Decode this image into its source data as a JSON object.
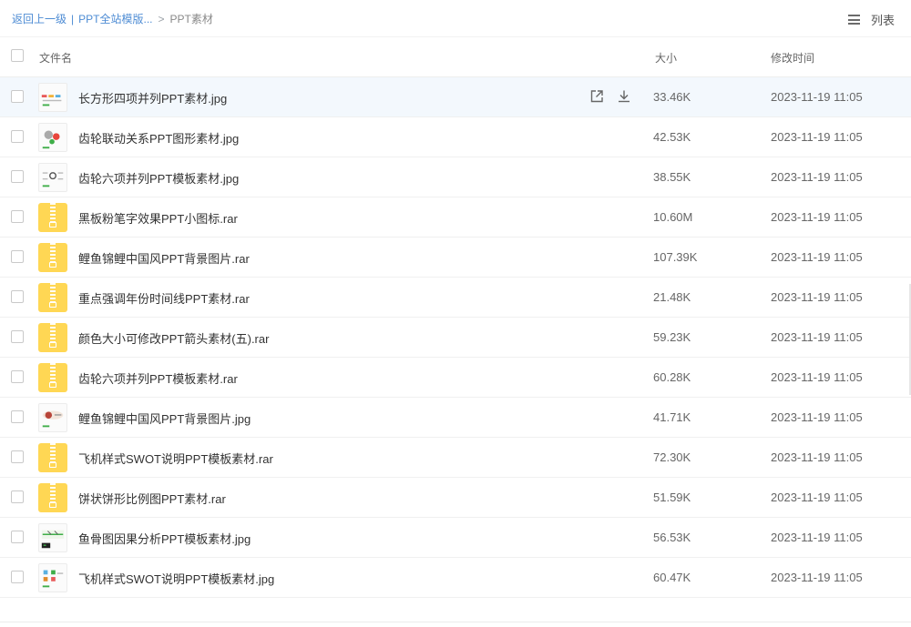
{
  "breadcrumb": {
    "back": "返回上一级",
    "separator": "|",
    "parent": "PPT全站模版...",
    "arrow": ">",
    "current": "PPT素材"
  },
  "view_toggle": {
    "label": "列表",
    "icon": "list-menu-icon"
  },
  "table": {
    "col_name": "文件名",
    "col_size": "大小",
    "col_time": "修改时间"
  },
  "row_actions": {
    "open_icon": "open-external-icon",
    "download_icon": "download-icon"
  },
  "rows": [
    {
      "name": "长方形四项并列PPT素材.jpg",
      "size": "33.46K",
      "time": "2023-11-19 11:05",
      "type": "image",
      "thumb_accent": "#e85a5a"
    },
    {
      "name": "齿轮联动关系PPT图形素材.jpg",
      "size": "42.53K",
      "time": "2023-11-19 11:05",
      "type": "image",
      "thumb_accent": "#e8463c"
    },
    {
      "name": "齿轮六项并列PPT模板素材.jpg",
      "size": "38.55K",
      "time": "2023-11-19 11:05",
      "type": "image",
      "thumb_accent": "#555555"
    },
    {
      "name": "黑板粉笔字效果PPT小图标.rar",
      "size": "10.60M",
      "time": "2023-11-19 11:05",
      "type": "archive"
    },
    {
      "name": "鲤鱼锦鲤中国风PPT背景图片.rar",
      "size": "107.39K",
      "time": "2023-11-19 11:05",
      "type": "archive"
    },
    {
      "name": "重点强调年份时间线PPT素材.rar",
      "size": "21.48K",
      "time": "2023-11-19 11:05",
      "type": "archive"
    },
    {
      "name": "颜色大小可修改PPT箭头素材(五).rar",
      "size": "59.23K",
      "time": "2023-11-19 11:05",
      "type": "archive"
    },
    {
      "name": "齿轮六项并列PPT模板素材.rar",
      "size": "60.28K",
      "time": "2023-11-19 11:05",
      "type": "archive"
    },
    {
      "name": "鲤鱼锦鲤中国风PPT背景图片.jpg",
      "size": "41.71K",
      "time": "2023-11-19 11:05",
      "type": "image",
      "thumb_accent": "#b8453a"
    },
    {
      "name": "飞机样式SWOT说明PPT模板素材.rar",
      "size": "72.30K",
      "time": "2023-11-19 11:05",
      "type": "archive"
    },
    {
      "name": "饼状饼形比例图PPT素材.rar",
      "size": "51.59K",
      "time": "2023-11-19 11:05",
      "type": "archive"
    },
    {
      "name": "鱼骨图因果分析PPT模板素材.jpg",
      "size": "56.53K",
      "time": "2023-11-19 11:05",
      "type": "image",
      "thumb_accent": "#3fae49"
    },
    {
      "name": "飞机样式SWOT说明PPT模板素材.jpg",
      "size": "60.47K",
      "time": "2023-11-19 11:05",
      "type": "image",
      "thumb_accent": "#e08a2a"
    }
  ],
  "colors": {
    "link": "#4e8cd4",
    "archive_icon": "#ffd754",
    "hover_row": "#f3f8fd"
  }
}
